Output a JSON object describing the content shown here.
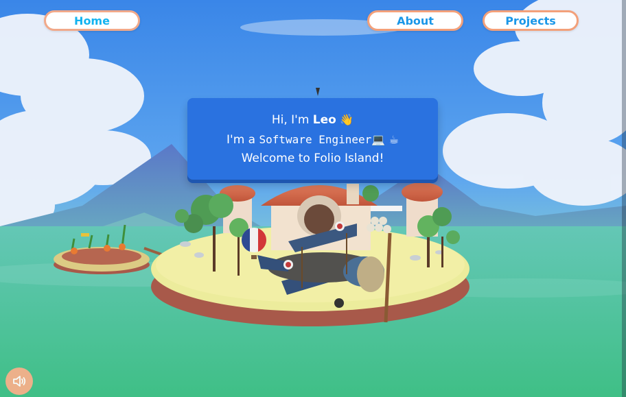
{
  "nav": {
    "home_label": "Home",
    "about_label": "About",
    "projects_label": "Projects"
  },
  "intro": {
    "greeting_prefix": "Hi, I'm ",
    "name": "Leo",
    "wave_emoji": "👋",
    "role_prefix": "I'm a ",
    "role": "Software Engineer",
    "laptop_emoji": "💻",
    "coffee_emoji": "☕",
    "welcome": "Welcome to Folio Island!"
  },
  "sound": {
    "icon": "speaker-icon"
  },
  "colors": {
    "nav_text": "#1a97e8",
    "nav_border": "#f3a07a",
    "info_box": "#2a72e0",
    "sound_button": "#f6b08a"
  }
}
